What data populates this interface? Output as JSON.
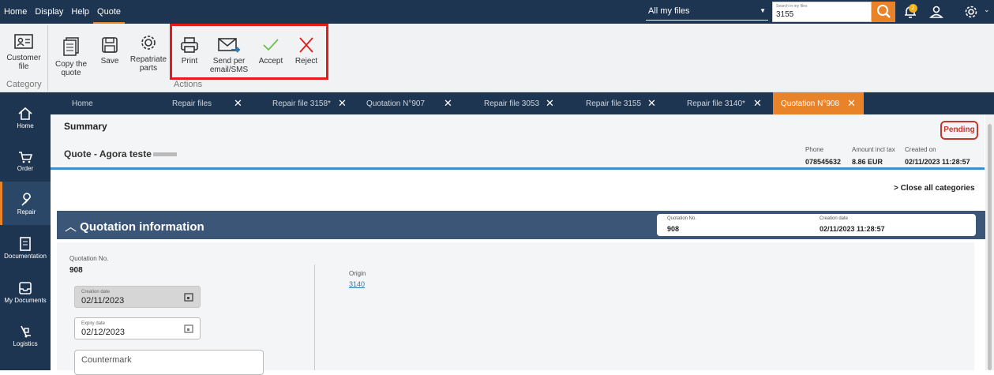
{
  "menu": {
    "items": [
      {
        "label": "Home"
      },
      {
        "label": "Display"
      },
      {
        "label": "Help"
      },
      {
        "label": "Quote"
      }
    ]
  },
  "topbar": {
    "file_selector": "All my files",
    "search_placeholder": "Search in my files",
    "search_value": "3155",
    "notification_count": "2"
  },
  "ribbon": {
    "customer_file": "Customer file",
    "category_label": "Category",
    "copy_quote": "Copy the quote",
    "save": "Save",
    "repatriate": "Repatriate parts",
    "print": "Print",
    "send": "Send per email/SMS",
    "accept": "Accept",
    "reject": "Reject",
    "actions_label": "Actions"
  },
  "sidebar": {
    "items": [
      {
        "label": "Home",
        "icon": "home-icon"
      },
      {
        "label": "Order",
        "icon": "cart-icon"
      },
      {
        "label": "Repair",
        "icon": "wrench-icon"
      },
      {
        "label": "Documentation",
        "icon": "doc-icon"
      },
      {
        "label": "My Documents",
        "icon": "inbox-icon"
      },
      {
        "label": "Logistics",
        "icon": "logistics-icon"
      }
    ]
  },
  "tabs": [
    {
      "label": "Home"
    },
    {
      "label": "Repair files"
    },
    {
      "label": "Repair file 3158*"
    },
    {
      "label": "Quotation N°907"
    },
    {
      "label": "Repair file 3053"
    },
    {
      "label": "Repair file 3155"
    },
    {
      "label": "Repair file 3140*"
    },
    {
      "label": "Quotation N°908"
    }
  ],
  "summary": {
    "title": "Summary",
    "quote_name": "Quote - Agora teste",
    "status": "Pending",
    "phone_label": "Phone",
    "phone": "078545632",
    "amount_label": "Amount incl tax",
    "amount": "8.86 EUR",
    "created_label": "Created on",
    "created": "02/11/2023 11:28:57",
    "close_all": "> Close all categories"
  },
  "quotation": {
    "header": "Quotation information",
    "no_label": "Quotation No.",
    "no": "908",
    "date_label": "Creation date",
    "date": "02/11/2023 11:28:57"
  },
  "form": {
    "no_label": "Quotation No.",
    "no": "908",
    "creation_label": "Creation date",
    "creation": "02/11/2023",
    "expiry_label": "Expiry date",
    "expiry": "02/12/2023",
    "countermark_placeholder": "Countermark",
    "origin_label": "Origin",
    "origin": "3140"
  },
  "colors": {
    "navy": "#1d3551",
    "accent": "#e8832a",
    "status_red": "#c0392b",
    "highlight_red": "#e21b1b"
  }
}
